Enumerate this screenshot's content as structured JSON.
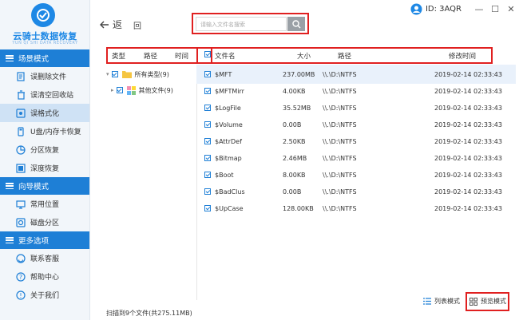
{
  "app": {
    "title": "云骑士数据恢复",
    "subtitle": "YUN QI SHI DATA RECOVERY"
  },
  "window": {
    "user_id": "ID: 3AQR",
    "minimize": "—",
    "maximize": "☐",
    "close": "✕"
  },
  "sidebar": {
    "sections": [
      {
        "title": "场景模式",
        "items": [
          {
            "label": "误删除文件",
            "icon": "file-delete-icon"
          },
          {
            "label": "误清空回收站",
            "icon": "recycle-bin-icon"
          },
          {
            "label": "误格式化",
            "icon": "format-icon",
            "active": true
          },
          {
            "label": "U盘/内存卡恢复",
            "icon": "usb-drive-icon"
          },
          {
            "label": "分区恢复",
            "icon": "partition-icon"
          },
          {
            "label": "深度恢复",
            "icon": "deep-scan-icon"
          }
        ]
      },
      {
        "title": "向导模式",
        "items": [
          {
            "label": "常用位置",
            "icon": "monitor-icon"
          },
          {
            "label": "磁盘分区",
            "icon": "disk-icon"
          }
        ]
      },
      {
        "title": "更多选项",
        "items": [
          {
            "label": "联系客服",
            "icon": "headset-icon"
          },
          {
            "label": "帮助中心",
            "icon": "help-icon"
          },
          {
            "label": "关于我们",
            "icon": "info-icon"
          }
        ]
      }
    ]
  },
  "nav": {
    "back": "返",
    "home": "回"
  },
  "search": {
    "placeholder": "请输入文件名搜索"
  },
  "tree_header": {
    "type": "类型",
    "path": "路径",
    "time": "时间"
  },
  "tree": {
    "items": [
      {
        "label": "所有类型(9)",
        "icon": "folder-icon"
      },
      {
        "label": "其他文件(9)",
        "icon": "other-files-icon"
      }
    ]
  },
  "table": {
    "columns": [
      "文件名",
      "大小",
      "路径",
      "修改时间"
    ],
    "rows": [
      {
        "name": "$MFT",
        "size": "237.00MB",
        "path": "\\\\.\\D:\\NTFS",
        "time": "2019-02-14 02:33:43"
      },
      {
        "name": "$MFTMirr",
        "size": "4.00KB",
        "path": "\\\\.\\D:\\NTFS",
        "time": "2019-02-14 02:33:43"
      },
      {
        "name": "$LogFile",
        "size": "35.52MB",
        "path": "\\\\.\\D:\\NTFS",
        "time": "2019-02-14 02:33:43"
      },
      {
        "name": "$Volume",
        "size": "0.00B",
        "path": "\\\\.\\D:\\NTFS",
        "time": "2019-02-14 02:33:43"
      },
      {
        "name": "$AttrDef",
        "size": "2.50KB",
        "path": "\\\\.\\D:\\NTFS",
        "time": "2019-02-14 02:33:43"
      },
      {
        "name": "$Bitmap",
        "size": "2.46MB",
        "path": "\\\\.\\D:\\NTFS",
        "time": "2019-02-14 02:33:43"
      },
      {
        "name": "$Boot",
        "size": "8.00KB",
        "path": "\\\\.\\D:\\NTFS",
        "time": "2019-02-14 02:33:43"
      },
      {
        "name": "$BadClus",
        "size": "0.00B",
        "path": "\\\\.\\D:\\NTFS",
        "time": "2019-02-14 02:33:43"
      },
      {
        "name": "$UpCase",
        "size": "128.00KB",
        "path": "\\\\.\\D:\\NTFS",
        "time": "2019-02-14 02:33:43"
      }
    ]
  },
  "status": "扫描到9个文件(共275.11MB)",
  "view": {
    "list": "列表模式",
    "preview": "预览模式"
  },
  "colors": {
    "accent": "#1e7fd6",
    "highlight": "#e02020",
    "selected_row": "#e9f1fb",
    "sidebar_active": "#cfe2f5"
  }
}
